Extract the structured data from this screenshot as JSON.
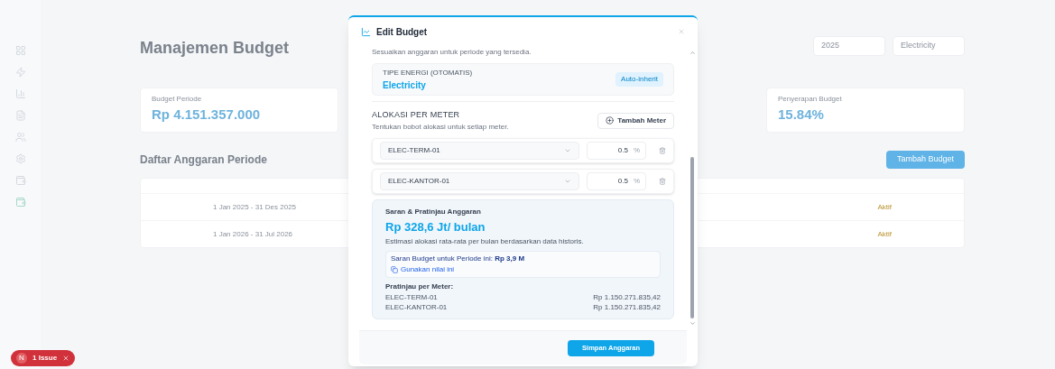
{
  "background": {
    "title": "Manajemen Budget",
    "cards": [
      {
        "label": "Budget Periode",
        "value": "Rp 4.151.357.000"
      },
      {
        "label": "Penyerapan Budget",
        "value": "15.84%"
      }
    ],
    "filters": [
      "2025",
      "Electricity"
    ],
    "section_title": "Daftar Anggaran Periode",
    "add_button": "Tambah Budget",
    "rows": [
      {
        "period": "1 Jan 2025 - 31 Des 2025",
        "status": "Aktif"
      },
      {
        "period": "1 Jan 2026 - 31 Jul 2026",
        "status": "Aktif"
      }
    ]
  },
  "modal": {
    "title": "Edit Budget",
    "intro": "Sesuaikan anggaran untuk periode yang tersedia.",
    "energy": {
      "label": "TIPE ENERGI (OTOMATIS)",
      "value": "Electricity",
      "badge": "Auto-inherit"
    },
    "allocation": {
      "title": "ALOKASI PER METER",
      "hint": "Tentukan bobot alokasi untuk setiap meter.",
      "add_button": "Tambah Meter",
      "meters": [
        {
          "name": "ELEC-TERM-01",
          "weight": "0.5",
          "unit": "%"
        },
        {
          "name": "ELEC-KANTOR-01",
          "weight": "0.5",
          "unit": "%"
        }
      ]
    },
    "suggestion": {
      "title": "Saran & Pratinjau Anggaran",
      "amount": "Rp 328,6 Jt/ bulan",
      "note": "Estimasi alokasi rata-rata per bulan berdasarkan data historis.",
      "budget_text": "Saran Budget untuk Periode ini: **Rp 3,9 M**",
      "use_link": "Gunakan nilai ini",
      "preview_title": "Pratinjau per Meter:",
      "preview": [
        {
          "meter": "ELEC-TERM-01",
          "amount": "Rp 1.150.271.835,42"
        },
        {
          "meter": "ELEC-KANTOR-01",
          "amount": "Rp 1.150.271.835,42"
        }
      ]
    },
    "save_button": "Simpan Anggaran"
  },
  "issue_badge": {
    "letter": "N",
    "text": "1 Issue"
  }
}
